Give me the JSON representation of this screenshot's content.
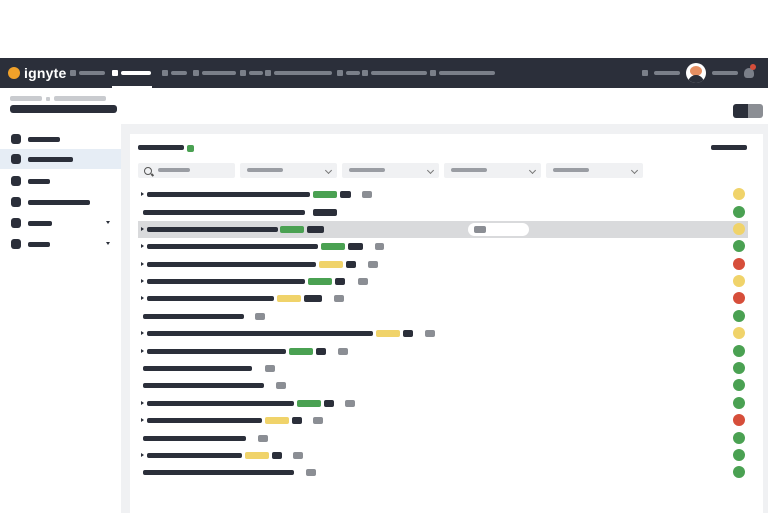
{
  "app": {
    "logo_text": "ignyte"
  },
  "topbar": {
    "nav_items": [
      "",
      "",
      "",
      "",
      "",
      "",
      "",
      "",
      ""
    ],
    "active_index": 1
  },
  "colors": {
    "nav_bg": "#2b2f3a",
    "green": "#4aa152",
    "yellow": "#f0d36a",
    "red": "#d64e3a",
    "gray": "#8b8e94"
  },
  "icons": {
    "logo": "ignyte-logo-icon",
    "user_avatar": "avatar-icon",
    "notifications": "bell-icon",
    "search": "search-icon",
    "expand": "caret-right-icon"
  },
  "rows": [
    {
      "expandable": true,
      "status": "yellow",
      "tags": [
        "green",
        "dark",
        "gray"
      ]
    },
    {
      "expandable": false,
      "status": "green",
      "tags": [
        "dark"
      ]
    },
    {
      "expandable": true,
      "status": "yellow",
      "tags": [
        "green",
        "dark",
        "gray"
      ],
      "selected": true
    },
    {
      "expandable": true,
      "status": "green",
      "tags": [
        "green",
        "dark",
        "gray"
      ]
    },
    {
      "expandable": true,
      "status": "red",
      "tags": [
        "yellow",
        "dark",
        "gray"
      ]
    },
    {
      "expandable": true,
      "status": "yellow",
      "tags": [
        "green",
        "dark",
        "gray"
      ]
    },
    {
      "expandable": true,
      "status": "red",
      "tags": [
        "yellow",
        "dark",
        "gray"
      ]
    },
    {
      "expandable": false,
      "status": "green",
      "tags": [
        "gray"
      ]
    },
    {
      "expandable": true,
      "status": "yellow",
      "tags": [
        "yellow",
        "dark",
        "gray"
      ]
    },
    {
      "expandable": true,
      "status": "green",
      "tags": [
        "green",
        "dark",
        "gray"
      ]
    },
    {
      "expandable": false,
      "status": "green",
      "tags": [
        "gray"
      ]
    },
    {
      "expandable": false,
      "status": "green",
      "tags": [
        "gray"
      ]
    },
    {
      "expandable": true,
      "status": "green",
      "tags": [
        "green",
        "dark",
        "gray"
      ]
    },
    {
      "expandable": true,
      "status": "red",
      "tags": [
        "yellow",
        "dark",
        "gray"
      ]
    },
    {
      "expandable": false,
      "status": "green",
      "tags": [
        "gray"
      ]
    },
    {
      "expandable": true,
      "status": "green",
      "tags": [
        "yellow",
        "dark",
        "gray"
      ]
    },
    {
      "expandable": false,
      "status": "green",
      "tags": [
        "gray"
      ]
    }
  ]
}
